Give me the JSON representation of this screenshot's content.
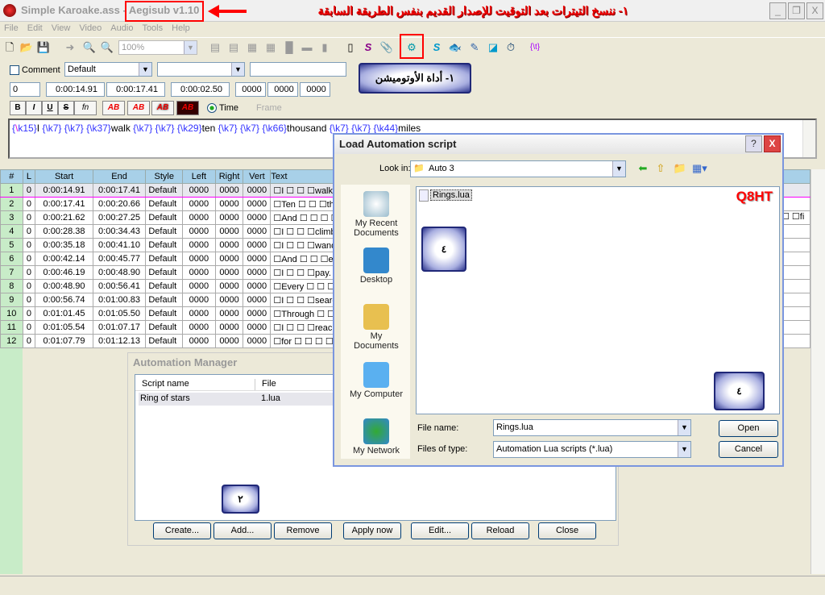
{
  "window": {
    "title": "Simple Karoake.ass - Aegisub v1.10",
    "annotation": "١- ننسخ التيترات بعد التوقيت للإصدار القديم بنفس الطريقة السابقة",
    "min": "_",
    "max": "❐",
    "close": "X"
  },
  "menu": [
    "File",
    "Edit",
    "View",
    "Video",
    "Audio",
    "Tools",
    "Help"
  ],
  "toolbar": {
    "zoom": "100%",
    "automation_callout": "١- أداة الأوتوميشن"
  },
  "edit": {
    "comment_label": "Comment",
    "style": "Default",
    "actor": "",
    "effect": "",
    "layer": "0",
    "start": "0:00:14.91",
    "end": "0:00:17.41",
    "duration": "0:00:02.50",
    "margin_l": "0000",
    "margin_r": "0000",
    "margin_v": "0000",
    "fmt": [
      "B",
      "I",
      "U",
      "S",
      "fn",
      "AB",
      "AB",
      "AB",
      "AB"
    ],
    "time_label": "Time",
    "frame_label": "Frame",
    "text": [
      {
        "t": "{",
        "c": "tag"
      },
      {
        "t": "\\",
        "c": "bs"
      },
      {
        "t": "k15",
        "c": "tag"
      },
      {
        "t": "}",
        "c": "tag"
      },
      {
        "t": "I ",
        "c": ""
      },
      {
        "t": "{\\k7} {\\k7} {\\k37}",
        "c": "tag"
      },
      {
        "t": "walk ",
        "c": ""
      },
      {
        "t": "{\\k7} {\\k7} {\\k29}",
        "c": "tag"
      },
      {
        "t": "ten ",
        "c": ""
      },
      {
        "t": "{\\k7} {\\k7} {\\k66}",
        "c": "tag"
      },
      {
        "t": "thousand ",
        "c": ""
      },
      {
        "t": "{\\k7} {\\k7} {\\k44}",
        "c": "tag"
      },
      {
        "t": "miles",
        "c": ""
      }
    ]
  },
  "grid": {
    "headers": [
      "#",
      "L",
      "Start",
      "End",
      "Style",
      "Left",
      "Right",
      "Vert",
      "Text"
    ],
    "rows": [
      [
        "1",
        "0",
        "0:00:14.91",
        "0:00:17.41",
        "Default",
        "0000",
        "0000",
        "0000",
        "☐I ☐ ☐ ☐walk ☐"
      ],
      [
        "2",
        "0",
        "0:00:17.41",
        "0:00:20.66",
        "Default",
        "0000",
        "0000",
        "0000",
        "☐Ten ☐ ☐ ☐thou"
      ],
      [
        "3",
        "0",
        "0:00:21.62",
        "0:00:27.25",
        "Default",
        "0000",
        "0000",
        "0000",
        "☐And ☐ ☐ ☐ ☐ev"
      ],
      [
        "4",
        "0",
        "0:00:28.38",
        "0:00:34.43",
        "Default",
        "0000",
        "0000",
        "0000",
        "☐I ☐ ☐ ☐climbed"
      ],
      [
        "5",
        "0",
        "0:00:35.18",
        "0:00:41.10",
        "Default",
        "0000",
        "0000",
        "0000",
        "☐I ☐ ☐ ☐wander"
      ],
      [
        "6",
        "0",
        "0:00:42.14",
        "0:00:45.77",
        "Default",
        "0000",
        "0000",
        "0000",
        "☐And ☐ ☐ ☐ever"
      ],
      [
        "7",
        "0",
        "0:00:46.19",
        "0:00:48.90",
        "Default",
        "0000",
        "0000",
        "0000",
        "☐I ☐ ☐ ☐pay."
      ],
      [
        "8",
        "0",
        "0:00:48.90",
        "0:00:56.41",
        "Default",
        "0000",
        "0000",
        "0000",
        "☐Every ☐ ☐ ☐sin"
      ],
      [
        "9",
        "0",
        "0:00:56.74",
        "0:01:00.83",
        "Default",
        "0000",
        "0000",
        "0000",
        "☐I ☐ ☐ ☐searche"
      ],
      [
        "10",
        "0",
        "0:01:01.45",
        "0:01:05.50",
        "Default",
        "0000",
        "0000",
        "0000",
        "☐Through ☐ ☐ ☐"
      ],
      [
        "11",
        "0",
        "0:01:05.54",
        "0:01:07.17",
        "Default",
        "0000",
        "0000",
        "0000",
        "☐I ☐ ☐ ☐reached"
      ],
      [
        "12",
        "0",
        "0:01:07.79",
        "0:01:12.13",
        "Default",
        "0000",
        "0000",
        "0000",
        "☐for ☐ ☐ ☐ ☐yo"
      ]
    ],
    "row3_overflow": "☐ ☐fi"
  },
  "manager": {
    "title": "Automation Manager",
    "col_script": "Script name",
    "col_file": "File",
    "script_name": "Ring of stars",
    "script_file": "1.lua",
    "buttons": [
      "Create...",
      "Add...",
      "Remove",
      "Apply now",
      "Edit...",
      "Reload",
      "Close"
    ],
    "callout": "٢"
  },
  "load": {
    "title": "Load Automation script",
    "help": "?",
    "close": "X",
    "look_in_label": "Look in:",
    "look_in": "Auto 3",
    "places": [
      "My Recent Documents",
      "Desktop",
      "My Documents",
      "My Computer",
      "My Network"
    ],
    "file": "Rings.lua",
    "watermark": "Q8HT",
    "file_name_label": "File name:",
    "file_name": "Rings.lua",
    "type_label": "Files of type:",
    "type": "Automation Lua scripts (*.lua)",
    "open": "Open",
    "cancel": "Cancel",
    "callout_file": "٤",
    "callout_open": "٤"
  },
  "colors": {
    "annotation_red": "#ff0000",
    "grid_header": "#a8d0e8",
    "row_number": "#c8ecc8",
    "callout": "#202878"
  }
}
